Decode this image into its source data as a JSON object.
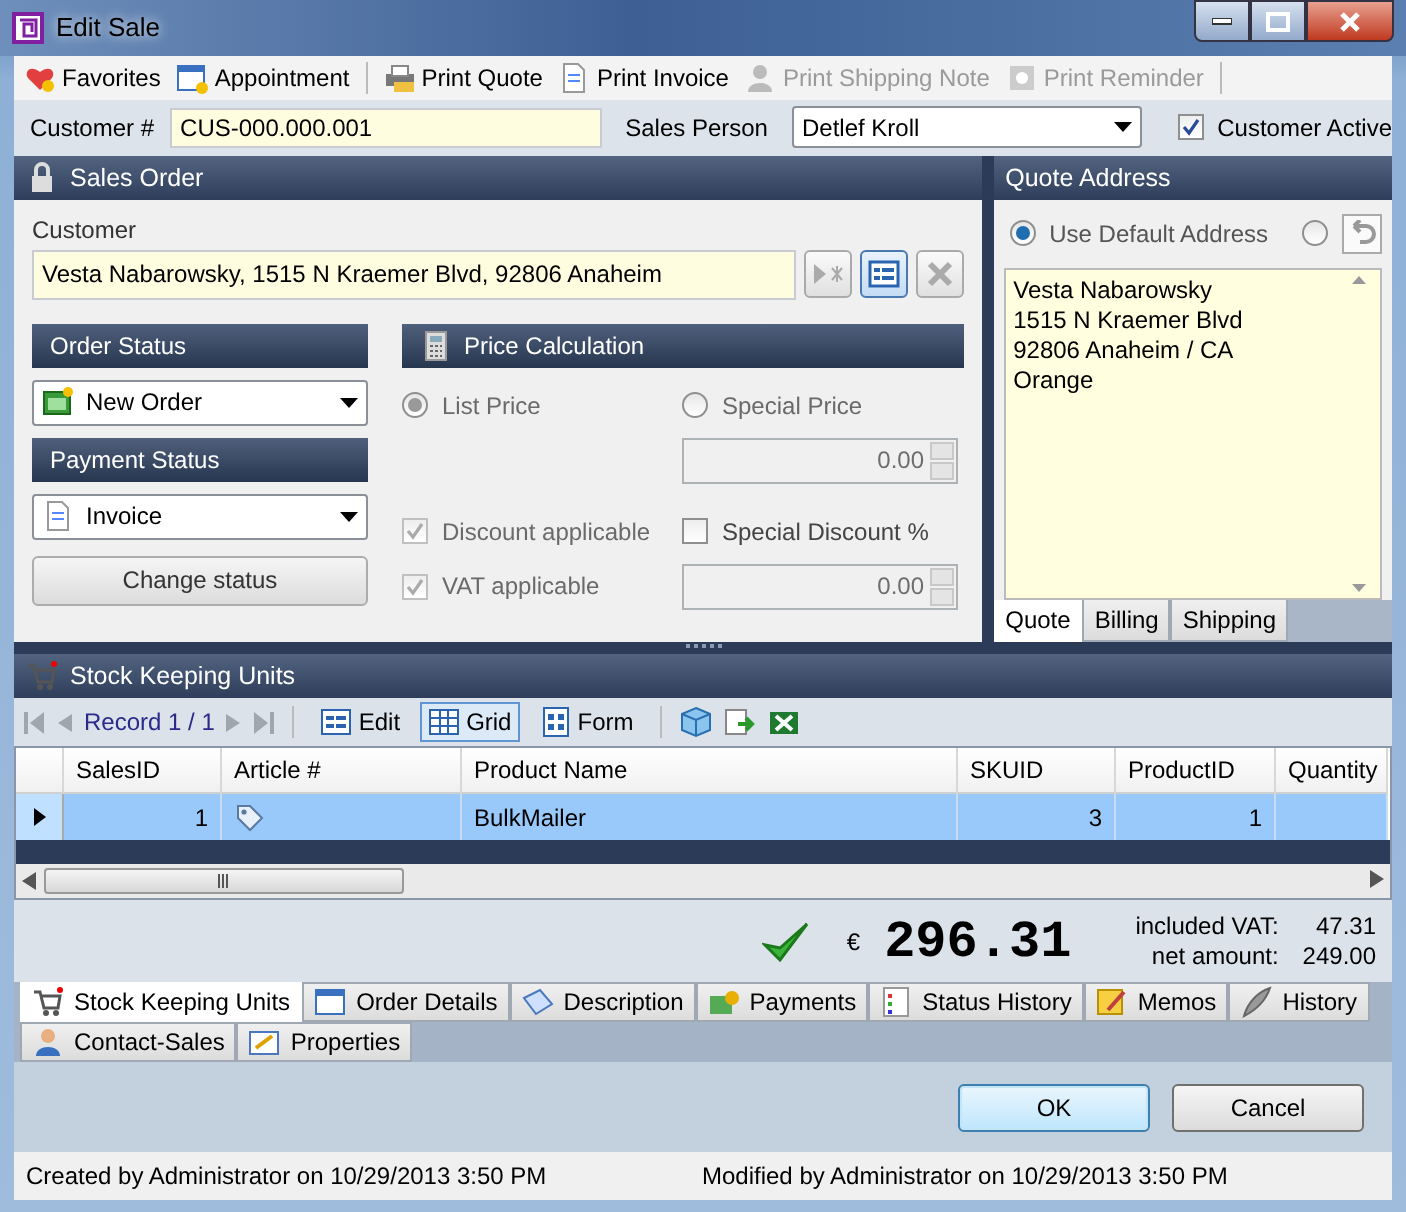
{
  "window": {
    "title": "Edit Sale"
  },
  "toolbar": {
    "groups": [
      [
        {
          "label": "Favorites",
          "disabled": false
        },
        {
          "label": "Appointment",
          "disabled": false
        }
      ],
      [
        {
          "label": "Print Quote",
          "disabled": false
        },
        {
          "label": "Print Invoice",
          "disabled": false
        },
        {
          "label": "Print Shipping Note",
          "disabled": true
        },
        {
          "label": "Print Reminder",
          "disabled": true
        }
      ]
    ]
  },
  "customer_number": {
    "label": "Customer #",
    "value": "CUS-000.000.001"
  },
  "sales_person": {
    "label": "Sales Person",
    "value": "Detlef Kroll"
  },
  "customer_active": {
    "label": "Customer Active",
    "checked": true
  },
  "sales_order": {
    "title": "Sales Order",
    "customer_label": "Customer",
    "customer_value": "Vesta Nabarowsky, 1515 N Kraemer Blvd, 92806 Anaheim",
    "order_status": {
      "title": "Order Status",
      "value": "New Order"
    },
    "payment_status": {
      "title": "Payment Status",
      "value": "Invoice"
    },
    "change_status_button": "Change status",
    "price_calculation": {
      "title": "Price Calculation",
      "options": [
        {
          "label": "List Price",
          "selected": true
        },
        {
          "label": "Special Price",
          "selected": false
        }
      ],
      "special_price": "0.00",
      "checks": [
        {
          "label": "Discount applicable",
          "checked": true,
          "disabled": true
        },
        {
          "label": "Special Discount %",
          "checked": false,
          "disabled": false
        },
        {
          "label": "VAT applicable",
          "checked": true,
          "disabled": true
        }
      ],
      "special_discount": "0.00"
    }
  },
  "quote_address": {
    "title": "Quote Address",
    "options": [
      {
        "label": "Use Default Address",
        "selected": true
      },
      {
        "selected": false
      }
    ],
    "lines": [
      "Vesta Nabarowsky",
      "1515 N Kraemer Blvd",
      "92806 Anaheim / CA",
      "Orange"
    ],
    "tabs": [
      {
        "label": "Quote",
        "selected": true
      },
      {
        "label": "Billing",
        "selected": false
      },
      {
        "label": "Shipping",
        "selected": false
      }
    ]
  },
  "stock_keeping_units": {
    "title": "Stock Keeping Units",
    "record": "Record 1 / 1",
    "views": [
      {
        "label": "Edit",
        "selected": false
      },
      {
        "label": "Grid",
        "selected": true
      },
      {
        "label": "Form",
        "selected": false
      }
    ],
    "columns": [
      "SalesID",
      "Article #",
      "Product Name",
      "SKUID",
      "ProductID",
      "Quantity"
    ],
    "rows": [
      {
        "cells": [
          "1",
          null,
          "BulkMailer",
          "3",
          "1",
          null
        ],
        "selected": true
      }
    ]
  },
  "totals": {
    "currency": "€",
    "amount": "296.31",
    "included_vat_label": "included VAT:",
    "included_vat": "47.31",
    "net_amount_label": "net amount:",
    "net_amount": "249.00"
  },
  "tab_rows": [
    [
      {
        "label": "Stock Keeping Units",
        "selected": true
      },
      {
        "label": "Order Details",
        "selected": false
      },
      {
        "label": "Description",
        "selected": false
      },
      {
        "label": "Payments",
        "selected": false
      },
      {
        "label": "Status History",
        "selected": false
      },
      {
        "label": "Memos",
        "selected": false
      },
      {
        "label": "History",
        "selected": false
      }
    ],
    [
      {
        "label": "Contact-Sales",
        "selected": false
      },
      {
        "label": "Properties",
        "selected": false
      }
    ]
  ],
  "buttons": [
    {
      "label": "OK",
      "default": true
    },
    {
      "label": "Cancel",
      "default": false
    }
  ],
  "status_bar": {
    "created": "Created by Administrator on 10/29/2013 3:50 PM",
    "modified": "Modified by Administrator on 10/29/2013 3:50 PM"
  }
}
